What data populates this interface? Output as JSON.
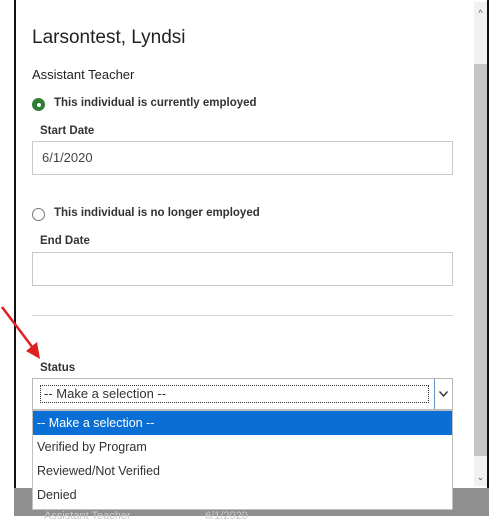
{
  "dialog": {
    "person_name": "Larsontest, Lyndsi",
    "role": "Assistant Teacher"
  },
  "employment": {
    "current_label": "This individual is currently employed",
    "current_selected": true,
    "start_date_label": "Start Date",
    "start_date_value": "6/1/2020",
    "former_label": "This individual is no longer employed",
    "former_selected": false,
    "end_date_label": "End Date",
    "end_date_value": ""
  },
  "status": {
    "label": "Status",
    "selected_value": "-- Make a selection --",
    "options": [
      "-- Make a selection --",
      "Verified by Program",
      "Reviewed/Not Verified",
      "Denied"
    ],
    "highlighted_index": 0
  },
  "background_row": {
    "text": "Assistant Teacher",
    "date": "6/1/2020"
  },
  "colors": {
    "radio_selected": "#2e7d32",
    "option_highlight": "#0a6fd4",
    "annotation_arrow": "#e02020"
  },
  "icons": {
    "dropdown": "chevron-down-icon",
    "scroll_up": "scroll-up-arrow-icon",
    "scroll_down": "scroll-down-arrow-icon",
    "annotation": "red-arrow-icon"
  }
}
